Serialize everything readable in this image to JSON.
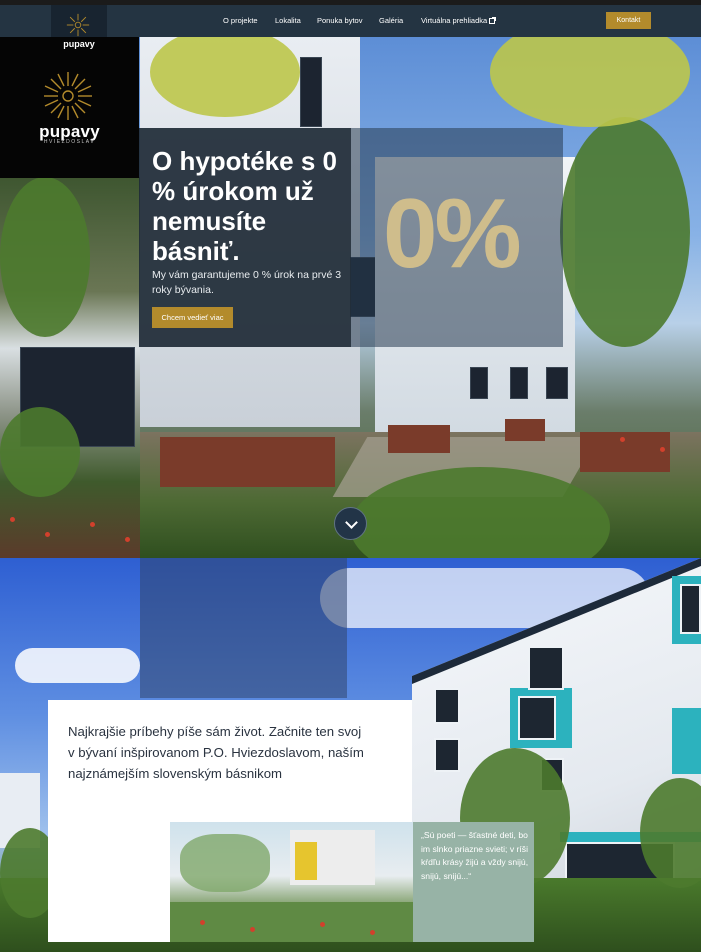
{
  "nav": {
    "brand": "pupavy",
    "links": [
      "O projekte",
      "Lokalita",
      "Ponuka bytov",
      "Galéria",
      "Virtuálna prehliadka"
    ],
    "cta": "Kontakt"
  },
  "logo": {
    "name": "pupavy",
    "tagline": "HVIEZDOSLAV"
  },
  "hero": {
    "title": "O hypotéke s 0 % úrokom už nemusíte básniť.",
    "subtitle": "My vám garantujeme 0 % úrok na prvé 3 roky bývania.",
    "button": "Chcem vedieť viac",
    "big_number": "0%"
  },
  "intro": {
    "text": "Najkrajšie príbehy píše sám život. Začnite ten svoj v bývaní inšpirovanom P.O. Hviezdoslavom, naším najznámejším slovenským básnikom",
    "quote": "„Sú poeti — šťastné deti, bo im slnko priazne svieti; v ríši kŕdľu krásy žijú a vždy snijú, snijú, snijú...“"
  },
  "colors": {
    "accent": "#b38b2c",
    "navy": "#243442",
    "gold_text": "#cfbd8c",
    "sage": "#97b3a6"
  }
}
